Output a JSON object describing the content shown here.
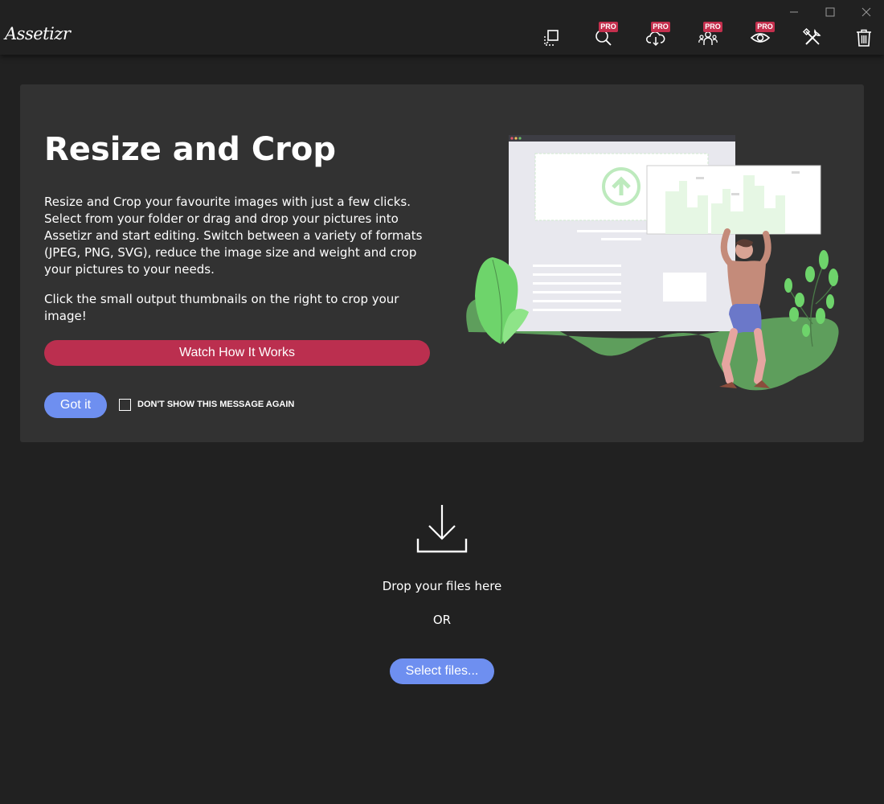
{
  "app": {
    "logo_text": "Assetizr"
  },
  "window_controls": [
    {
      "icon": "minimize-icon"
    },
    {
      "icon": "maximize-icon"
    },
    {
      "icon": "close-icon"
    }
  ],
  "toolbar": {
    "badge_label": "PRO",
    "tools": [
      {
        "icon": "resize-crop-icon",
        "pro": false
      },
      {
        "icon": "search-icon",
        "pro": true
      },
      {
        "icon": "cloud-download-icon",
        "pro": true
      },
      {
        "icon": "users-icon",
        "pro": true
      },
      {
        "icon": "eye-icon",
        "pro": true
      },
      {
        "icon": "tools-icon",
        "pro": false
      },
      {
        "icon": "trash-icon",
        "pro": false
      }
    ]
  },
  "info_card": {
    "title": "Resize and Crop",
    "paragraph1": "Resize and Crop your favourite images with just a few clicks. Select from your folder or drag and drop your pictures into Assetizr and start editing. Switch between a variety of formats (JPEG, PNG, SVG), reduce the image size and weight and crop your pictures to your needs.",
    "paragraph2": "Click the small output thumbnails on the right to crop your image!",
    "watch_button": "Watch How It Works",
    "got_it_button": "Got it",
    "dont_show_label": "DON'T SHOW THIS MESSAGE AGAIN",
    "dont_show_checked": false
  },
  "drop_zone": {
    "icon": "download-icon",
    "drop_text": "Drop your files here",
    "or_text": "OR",
    "select_button": "Select files..."
  },
  "colors": {
    "background": "#212121",
    "card": "#323232",
    "primary_button": "#6e8ff0",
    "watch_button": "#bb2f4f",
    "pro_badge": "#c42f4d",
    "illustration_green": "#6abf69"
  }
}
